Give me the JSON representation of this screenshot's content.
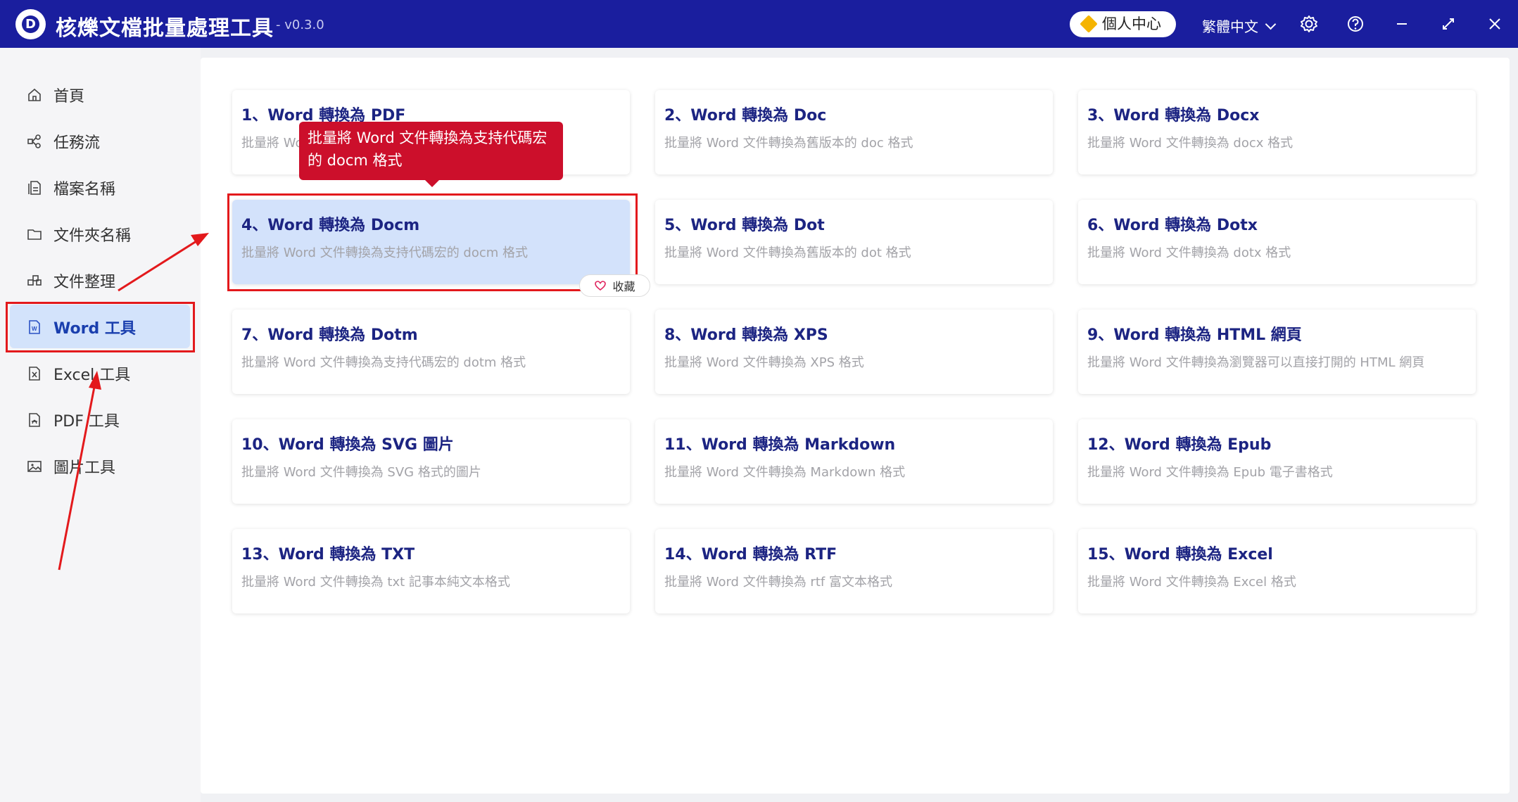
{
  "app": {
    "title": "核爍文檔批量處理工具",
    "version": "- v0.3.0",
    "personal_center": "個人中心",
    "language": "繁體中文"
  },
  "titlebar_icons": [
    "settings-icon",
    "help-icon",
    "minimize-icon",
    "maximize-icon",
    "close-icon"
  ],
  "sidebar": {
    "items": [
      {
        "label": "首頁",
        "icon": "home-icon"
      },
      {
        "label": "任務流",
        "icon": "workflow-icon"
      },
      {
        "label": "檔案名稱",
        "icon": "file-name-icon"
      },
      {
        "label": "文件夾名稱",
        "icon": "folder-icon"
      },
      {
        "label": "文件整理",
        "icon": "organize-icon"
      },
      {
        "label": "Word 工具",
        "icon": "word-icon",
        "active": true
      },
      {
        "label": "Excel 工具",
        "icon": "excel-icon"
      },
      {
        "label": "PDF 工具",
        "icon": "pdf-icon"
      },
      {
        "label": "圖片工具",
        "icon": "image-icon"
      }
    ]
  },
  "tools": [
    {
      "title": "1、Word 轉換為 PDF",
      "desc": "批量將 Word 文件轉換為 PDF 格式"
    },
    {
      "title": "2、Word 轉換為 Doc",
      "desc": "批量將 Word 文件轉換為舊版本的 doc 格式"
    },
    {
      "title": "3、Word 轉換為 Docx",
      "desc": "批量將 Word 文件轉換為 docx 格式"
    },
    {
      "title": "4、Word 轉換為 Docm",
      "desc": "批量將 Word 文件轉換為支持代碼宏的 docm 格式"
    },
    {
      "title": "5、Word 轉換為 Dot",
      "desc": "批量將 Word 文件轉換為舊版本的 dot 格式"
    },
    {
      "title": "6、Word 轉換為 Dotx",
      "desc": "批量將 Word 文件轉換為 dotx 格式"
    },
    {
      "title": "7、Word 轉換為 Dotm",
      "desc": "批量將 Word 文件轉換為支持代碼宏的 dotm 格式"
    },
    {
      "title": "8、Word 轉換為 XPS",
      "desc": "批量將 Word 文件轉換為 XPS 格式"
    },
    {
      "title": "9、Word 轉換為 HTML 網頁",
      "desc": "批量將 Word 文件轉換為瀏覽器可以直接打開的 HTML 網頁"
    },
    {
      "title": "10、Word 轉換為 SVG 圖片",
      "desc": "批量將 Word 文件轉換為 SVG 格式的圖片"
    },
    {
      "title": "11、Word 轉換為 Markdown",
      "desc": "批量將 Word 文件轉換為 Markdown 格式"
    },
    {
      "title": "12、Word 轉換為 Epub",
      "desc": "批量將 Word 文件轉換為 Epub 電子書格式"
    },
    {
      "title": "13、Word 轉換為 TXT",
      "desc": "批量將 Word 文件轉換為 txt 記事本純文本格式"
    },
    {
      "title": "14、Word 轉換為 RTF",
      "desc": "批量將 Word 文件轉換為 rtf 富文本格式"
    },
    {
      "title": "15、Word 轉換為 Excel",
      "desc": "批量將 Word 文件轉換為 Excel 格式"
    }
  ],
  "tooltip": {
    "line1": "批量將 Word 文件轉換為支持代碼宏",
    "line2": "的 docm 格式"
  },
  "favorite_label": "收藏",
  "colors": {
    "titlebar": "#1a1e9e",
    "accent_title": "#1c2482",
    "highlight": "#e3191c",
    "tooltip": "#cc0f2b",
    "active_bg": "#d3e2fb"
  }
}
